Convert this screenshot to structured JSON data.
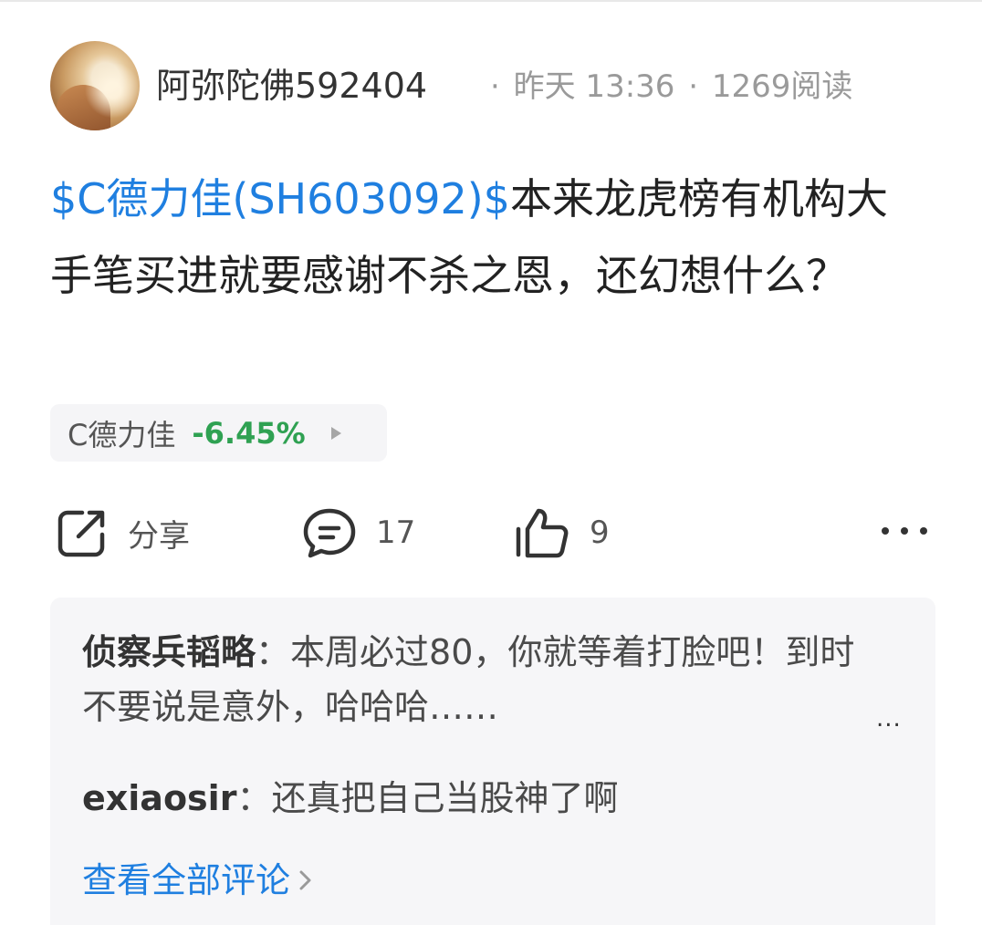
{
  "post": {
    "author": "阿弥陀佛592404",
    "time": "昨天 13:36",
    "reads": "1269阅读",
    "separator": "·",
    "stock_tag": "$C德力佳(SH603092)$",
    "body": "本来龙虎榜有机构大手笔买进就要感谢不杀之恩，还幻想什么？"
  },
  "stock_chip": {
    "name": "C德力佳",
    "change": "-6.45%",
    "change_color": "#2fa152"
  },
  "actions": {
    "share_label": "分享",
    "comment_count": "17",
    "like_count": "9",
    "icons": [
      "share-icon",
      "comment-icon",
      "thumbs-up-icon",
      "more-icon"
    ]
  },
  "comments": [
    {
      "author": "侦察兵韬略",
      "colon": "：",
      "text": "本周必过80，你就等着打脸吧！到时不要说是意外，哈哈哈……",
      "more": "..."
    },
    {
      "author": "exiaosir",
      "colon": "：",
      "text": "还真把自己当股神了啊"
    }
  ],
  "view_all": "查看全部评论",
  "colors": {
    "link_blue": "#1f7fe0",
    "text_dark": "#222222",
    "meta_gray": "#9a9a9a",
    "box_bg": "#f6f6f8"
  }
}
